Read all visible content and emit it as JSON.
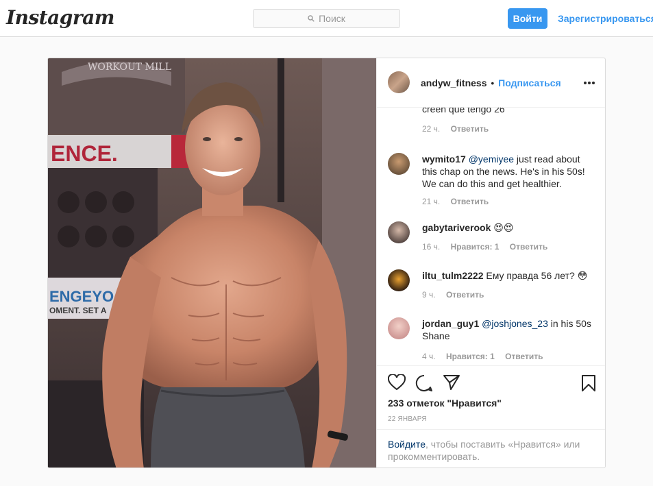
{
  "header": {
    "logo": "Instagram",
    "search_placeholder": "Поиск",
    "login_label": "Войти",
    "signup_label": "Зарегистрироваться"
  },
  "post": {
    "username": "andyw_fitness",
    "separator": "•",
    "follow_label": "Подписаться",
    "more_icon": "ellipsis-icon",
    "partial_comment_text": "creen que tengo 26",
    "partial_comment_meta": {
      "time": "22 ч.",
      "reply": "Ответить"
    },
    "comments": [
      {
        "user": "wymito17",
        "mention": "@yemiyee",
        "text": " just read about this chap on the news. He's in his 50s! We can do this and get healthier.",
        "time": "21 ч.",
        "likes": "",
        "reply": "Ответить"
      },
      {
        "user": "gabytariverook",
        "mention": "",
        "text": " 😍😍",
        "time": "16 ч.",
        "likes": "Нравится: 1",
        "reply": "Ответить"
      },
      {
        "user": "iltu_tulm2222",
        "mention": "",
        "text": " Ему правда 56 лет? 😳",
        "time": "9 ч.",
        "likes": "",
        "reply": "Ответить"
      },
      {
        "user": "jordan_guy1",
        "mention": "@joshjones_23",
        "text": " in his 50s Shane",
        "time": "4 ч.",
        "likes": "Нравится: 1",
        "reply": "Ответить"
      }
    ],
    "likes_count": "233 отметок \"Нравится\"",
    "date": "22 ЯНВАРЯ",
    "login_note_link": "Войдите",
    "login_note_text": ", чтобы поставить «Нравится» или прокомментировать.",
    "photo_sign_text": "WORKOUT MILL",
    "photo_banner_text": "ENCE.",
    "photo_wall_text": "ENGEYO",
    "photo_wall_text2": "OMENT. SET A"
  },
  "colors": {
    "accent": "#3897f0",
    "mention": "#003569",
    "muted": "#999999",
    "border": "#dbdbdb"
  }
}
